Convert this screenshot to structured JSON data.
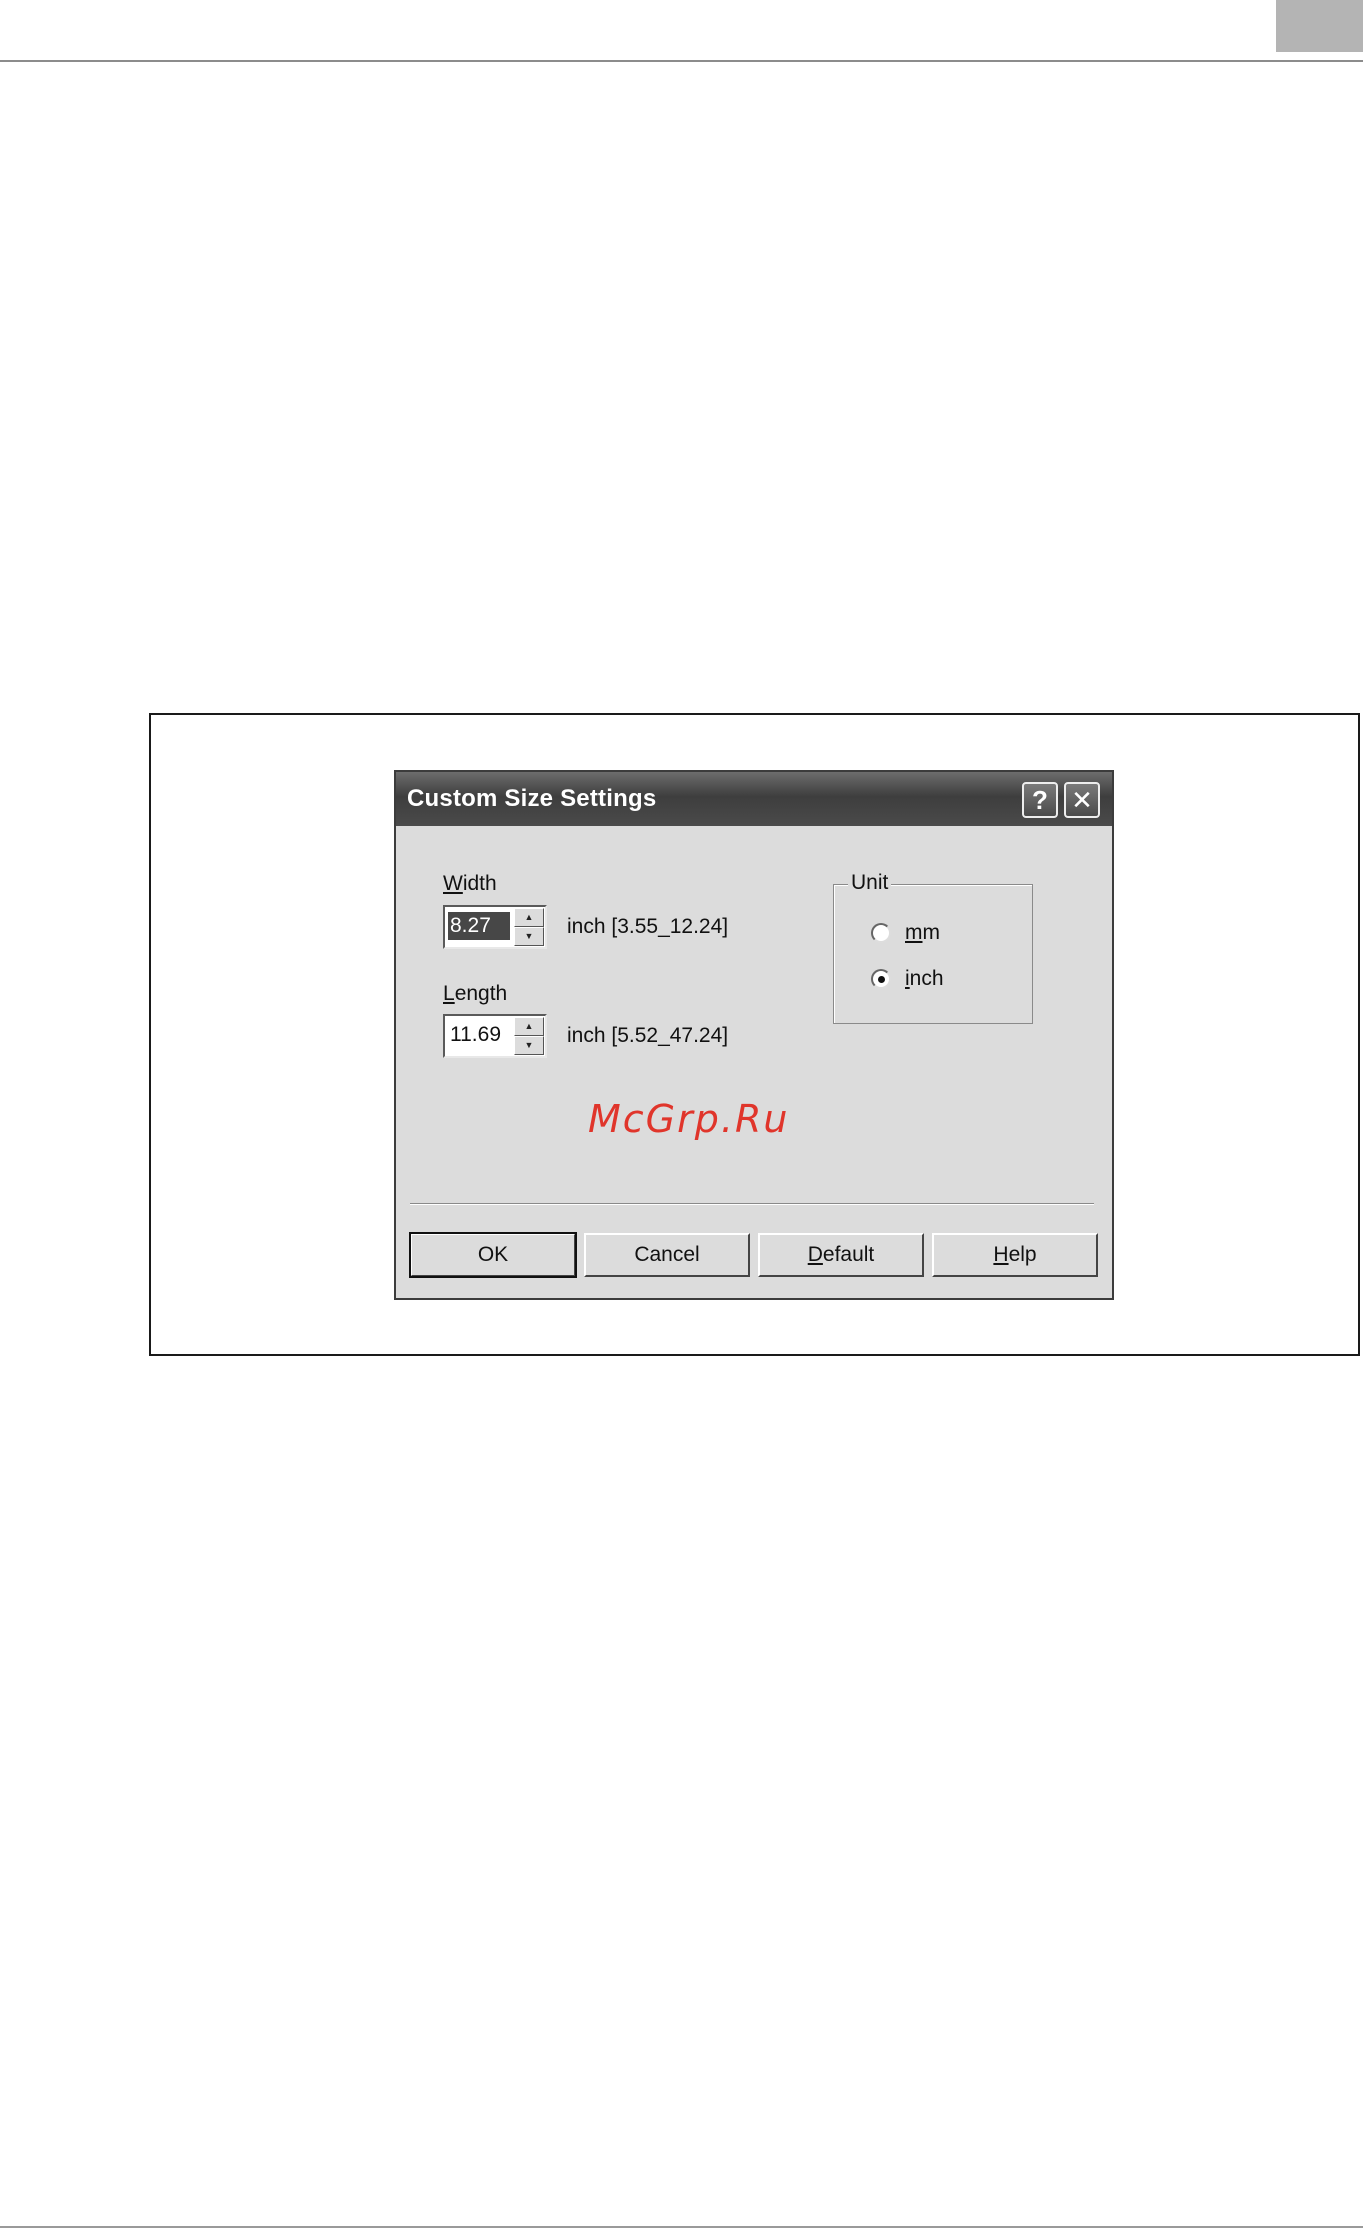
{
  "dialog": {
    "title": "Custom Size Settings",
    "help_glyph": "?",
    "close_glyph": "✕",
    "width": {
      "label_first": "W",
      "label_rest": "idth",
      "value": "8.27",
      "unit_range": "inch [3.55_12.24]"
    },
    "length": {
      "label_first": "L",
      "label_rest": "ength",
      "value": "11.69",
      "unit_range": "inch [5.52_47.24]"
    },
    "unit": {
      "legend": "Unit",
      "options": [
        {
          "first": "m",
          "rest": "m",
          "selected": false
        },
        {
          "first": "i",
          "rest": "nch",
          "selected": true
        }
      ]
    },
    "buttons": {
      "ok": "OK",
      "cancel": "Cancel",
      "default_first": "D",
      "default_rest": "efault",
      "help_first": "H",
      "help_rest": "elp"
    },
    "watermark": "McGrp.Ru"
  },
  "icons": {
    "spin_up": "▲",
    "spin_down": "▼"
  }
}
